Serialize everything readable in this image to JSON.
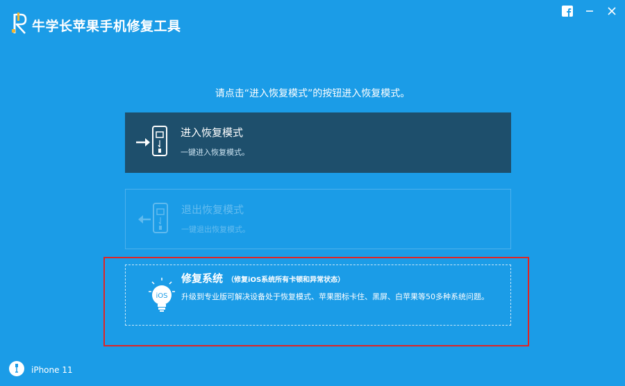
{
  "app": {
    "title": "牛学长苹果手机修复工具",
    "logo_icon": "reiboot-logo-icon",
    "accent_color": "#1b9ce7"
  },
  "titlebar": {
    "facebook_icon": "facebook-icon",
    "minimize_icon": "minimize-icon",
    "close_icon": "close-icon"
  },
  "instruction": "请点击“进入恢复模式”的按钮进入恢复模式。",
  "options": {
    "enter": {
      "title": "进入恢复模式",
      "desc": "一键进入恢复模式。",
      "icon": "phone-enter-icon",
      "state": "enabled",
      "bg_color": "#1e4f6c"
    },
    "exit": {
      "title": "退出恢复模式",
      "desc": "一键退出恢复模式。",
      "icon": "phone-exit-icon",
      "state": "disabled"
    },
    "repair": {
      "title": "修复系统",
      "subtitle": "（修复iOS系统所有卡顿和异常状态）",
      "desc": "升级到专业版可解决设备处于恢复模式、苹果图标卡住、黑屏、白苹果等50多种系统问题。",
      "icon": "ios-bulb-icon",
      "highlighted": true,
      "highlight_color": "#e02424"
    }
  },
  "device": {
    "name": "iPhone 11",
    "icon": "phone-cable-icon"
  }
}
